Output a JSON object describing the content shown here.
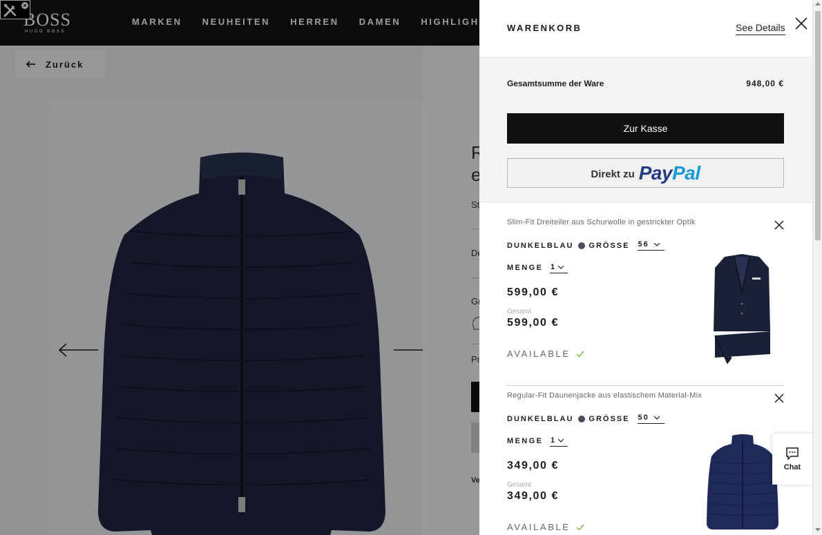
{
  "brand": {
    "name": "BOSS",
    "sub": "HUGO BOSS"
  },
  "nav": [
    "MARKEN",
    "NEUHEITEN",
    "HERREN",
    "DAMEN",
    "HIGHLIGHTS"
  ],
  "back": {
    "label": "Zurück"
  },
  "product_bg": {
    "title_fragment": "R",
    "title_fragment2": "e",
    "fragments": [
      "St",
      "De",
      "Gr",
      "Pr",
      "Ve"
    ]
  },
  "cart": {
    "title": "WARENKORB",
    "see_details": "See Details",
    "subtotal_label": "Gesamtsumme der Ware",
    "subtotal_value": "948,00 €",
    "checkout_label": "Zur Kasse",
    "paypal_prefix": "Direkt zu",
    "paypal_pay": "Pay",
    "paypal_pal": "Pal",
    "items": [
      {
        "name": "Slim-Fit Dreiteiler aus Schurwolle in gestrickter Optik",
        "color_label": "DUNKELBLAU",
        "size_label": "GRÖSSE",
        "size_value": "56",
        "qty_label": "MENGE",
        "qty_value": "1",
        "price": "599,00 €",
        "total_label": "Gesamt",
        "total": "599,00 €",
        "availability": "AVAILABLE"
      },
      {
        "name": "Regular-Fit Daunenjacke aus elastischem Material-Mix",
        "color_label": "DUNKELBLAU",
        "size_label": "GRÖSSE",
        "size_value": "50",
        "qty_label": "MENGE",
        "qty_value": "1",
        "price": "349,00 €",
        "total_label": "Gesamt",
        "total": "349,00 €",
        "availability": "AVAILABLE"
      }
    ]
  },
  "chat": {
    "label": "Chat"
  },
  "colors": {
    "dark": "#111111",
    "navy": "#1f2640",
    "paypal_blue": "#253b80",
    "paypal_light": "#179bd7",
    "check_green": "#7cb342"
  }
}
